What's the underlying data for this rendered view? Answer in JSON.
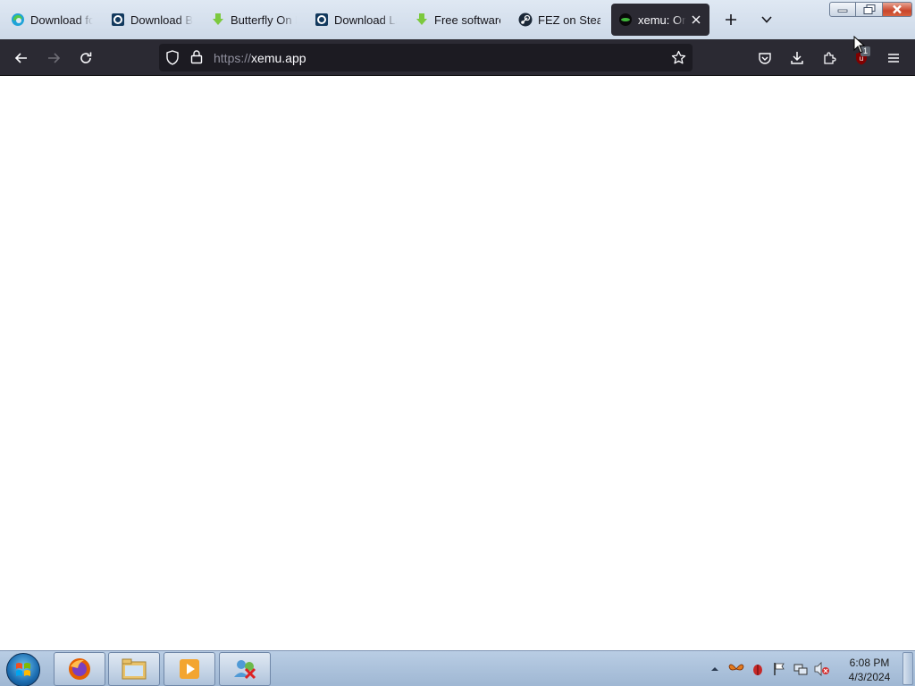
{
  "tabs": [
    {
      "label": "Download for",
      "icon": "edge-icon"
    },
    {
      "label": "Download Bu",
      "icon": "download-site-icon"
    },
    {
      "label": "Butterfly On L",
      "icon": "green-download-arrow-icon"
    },
    {
      "label": "Download La",
      "icon": "download-site-icon"
    },
    {
      "label": "Free software",
      "icon": "green-download-arrow-icon"
    },
    {
      "label": "FEZ on Steam",
      "icon": "steam-icon"
    },
    {
      "label": "xemu: Orig",
      "icon": "xemu-icon",
      "active": true
    }
  ],
  "address_bar": {
    "scheme": "https://",
    "host": "xemu.app"
  },
  "extension_badge": "1",
  "clock": {
    "time": "6:08 PM",
    "date": "4/3/2024"
  },
  "colors": {
    "toolbar": "#2b2a33",
    "urlbar": "#1c1b22",
    "active_tab": "#2b2a33",
    "taskbar": "#a9bed8"
  }
}
